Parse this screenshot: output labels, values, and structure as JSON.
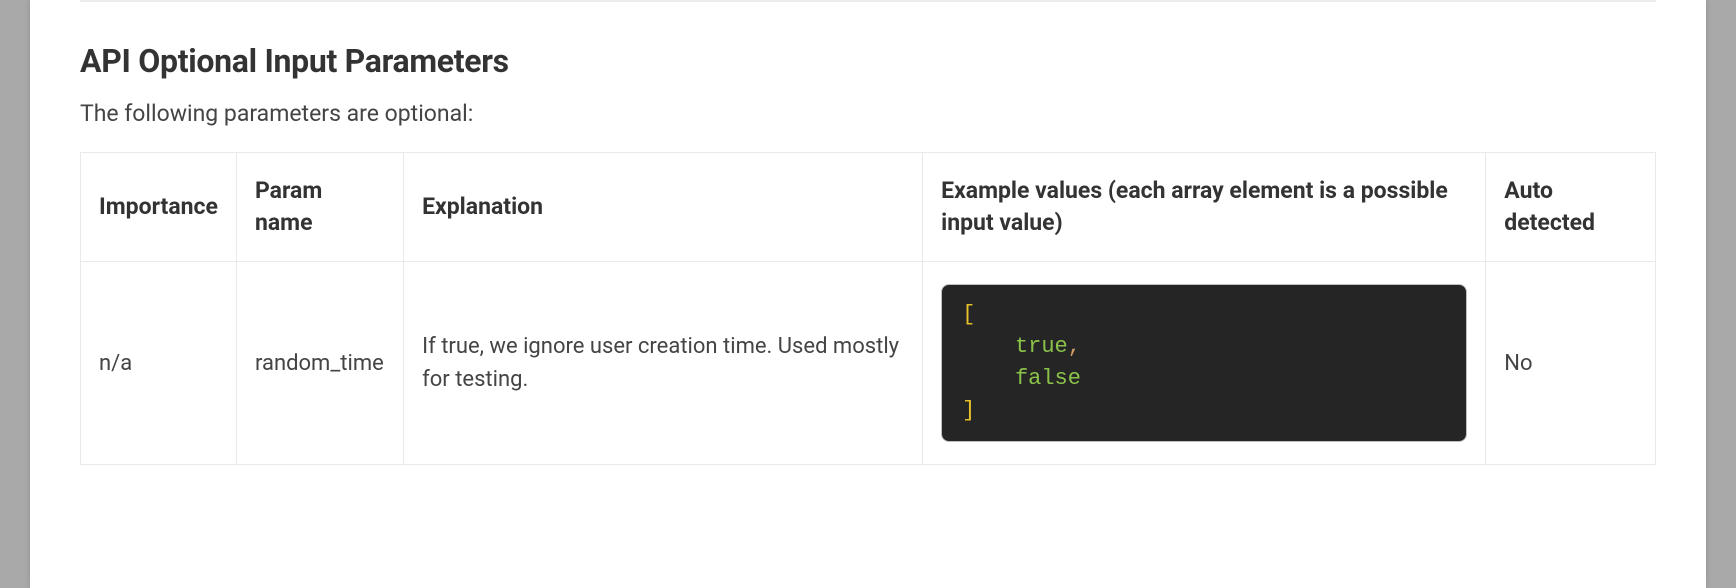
{
  "section": {
    "title": "API Optional Input Parameters",
    "description": "The following parameters are optional:"
  },
  "table": {
    "headers": {
      "importance": "Importance",
      "param_name": "Param name",
      "explanation": "Explanation",
      "example_values": "Example values (each array element is a possible input value)",
      "auto_detected": "Auto detected"
    },
    "rows": [
      {
        "importance": "n/a",
        "param_name": "random_time",
        "explanation": "If true, we ignore user creation time. Used mostly for testing.",
        "example_values_tokens": {
          "open": "[",
          "val1": "true",
          "comma": ",",
          "val2": "false",
          "close": "]"
        },
        "auto_detected": "No"
      }
    ]
  }
}
